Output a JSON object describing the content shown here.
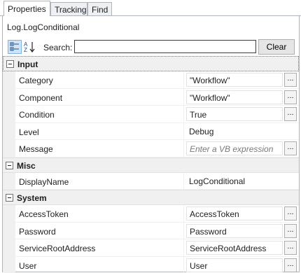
{
  "tabs": [
    {
      "label": "Properties",
      "active": true
    },
    {
      "label": "Tracking",
      "active": false
    },
    {
      "label": "Find",
      "active": false
    }
  ],
  "object_title": "Log.LogConditional",
  "toolbar": {
    "categorized_icon": "categorized-view-icon",
    "alphabetical_icon": "sort-alphabetical-icon",
    "search_label": "Search:",
    "search_value": "",
    "clear_label": "Clear"
  },
  "categories": [
    {
      "name": "Input",
      "properties": [
        {
          "name": "Category",
          "value": "\"Workflow\"",
          "has_button": true
        },
        {
          "name": "Component",
          "value": "\"Workflow\"",
          "has_button": true
        },
        {
          "name": "Condition",
          "value": "True",
          "has_button": true
        },
        {
          "name": "Level",
          "value": "Debug",
          "has_button": false
        },
        {
          "name": "Message",
          "placeholder": "Enter a VB expression",
          "has_button": true
        }
      ]
    },
    {
      "name": "Misc",
      "properties": [
        {
          "name": "DisplayName",
          "value": "LogConditional",
          "has_button": false
        }
      ]
    },
    {
      "name": "System",
      "properties": [
        {
          "name": "AccessToken",
          "value": "AccessToken",
          "has_button": true
        },
        {
          "name": "Password",
          "value": "Password",
          "has_button": true
        },
        {
          "name": "ServiceRootAddress",
          "value": "ServiceRootAddress",
          "has_button": true
        },
        {
          "name": "User",
          "value": "User",
          "has_button": true
        }
      ]
    }
  ],
  "ellipsis_label": "...",
  "colors": {
    "selected_tool": "#cfe4f7",
    "gutter": "#f0f0f0",
    "border": "#aeb4bd"
  }
}
